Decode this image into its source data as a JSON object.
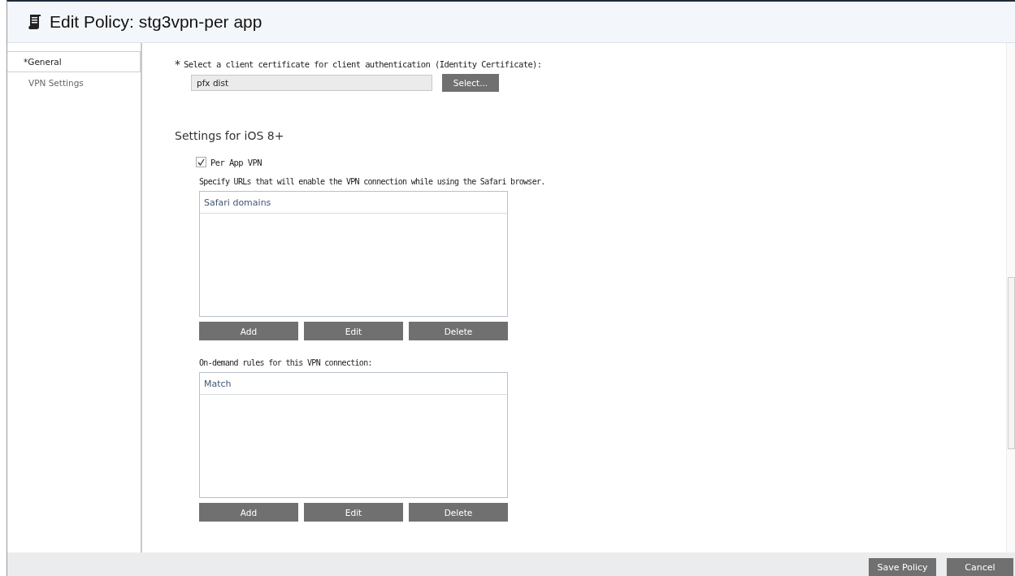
{
  "window": {
    "title": "Edit Policy: stg3vpn-per app"
  },
  "sidebar": {
    "items": [
      {
        "label": "*General",
        "selected": true
      },
      {
        "label": "VPN Settings",
        "selected": false
      }
    ]
  },
  "certificate": {
    "required_mark": "*",
    "label": "Select a client certificate for client authentication (Identity Certificate):",
    "value": "pfx dist",
    "button": "Select..."
  },
  "section_title": "Settings for iOS 8+",
  "per_app_vpn": {
    "label": "Per App VPN",
    "checked": true
  },
  "lists": [
    {
      "description": "Specify URLs that will enable the VPN connection while using the Safari browser.",
      "header": "Safari domains",
      "buttons": [
        "Add",
        "Edit",
        "Delete"
      ]
    },
    {
      "description": "On-demand rules for this VPN connection:",
      "header": "Match",
      "buttons": [
        "Add",
        "Edit",
        "Delete"
      ]
    }
  ],
  "footer": {
    "buttons": [
      "Save Policy",
      "Cancel"
    ]
  }
}
